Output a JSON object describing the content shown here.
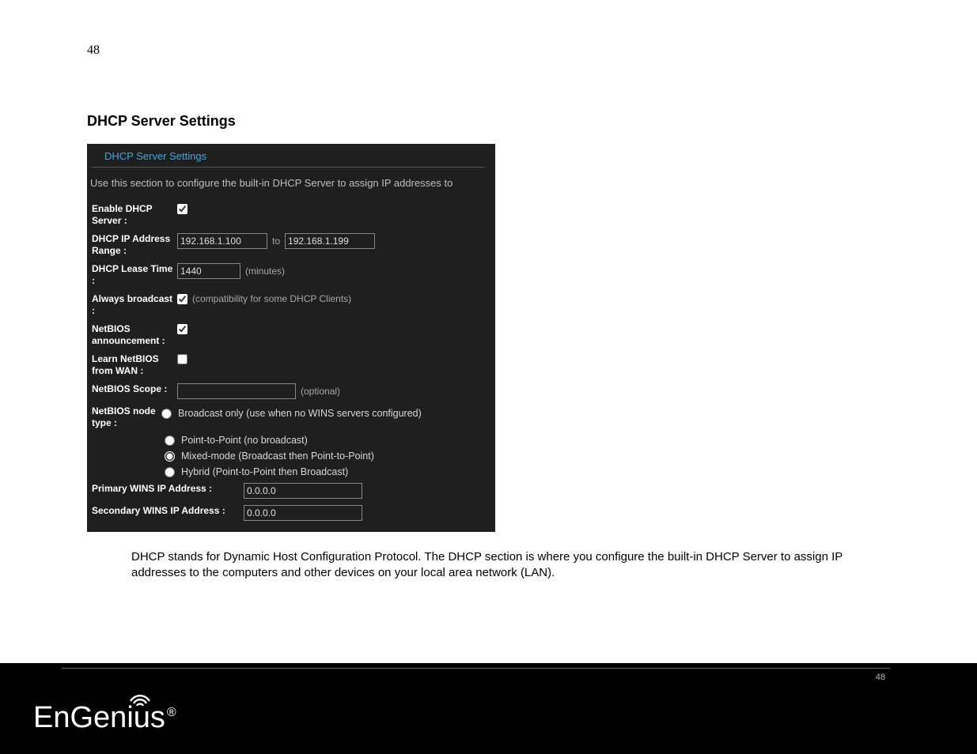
{
  "page_number_top": "48",
  "section_title": "DHCP Server Settings",
  "panel": {
    "header": "DHCP Server Settings",
    "description": "Use this section to configure the built-in DHCP Server to assign IP addresses to",
    "enable_label": "Enable DHCP Server :",
    "range_label": "DHCP IP Address Range :",
    "range_to": "to",
    "range_start": "192.168.1.100",
    "range_end": "192.168.1.199",
    "lease_label": "DHCP Lease Time :",
    "lease_value": "1440",
    "lease_hint": "(minutes)",
    "broadcast_label": "Always broadcast :",
    "broadcast_hint": "(compatibility for some DHCP Clients)",
    "netbios_ann_label": "NetBIOS announcement :",
    "learn_wan_label": "Learn NetBIOS from WAN :",
    "scope_label": "NetBIOS Scope :",
    "scope_value": "",
    "scope_hint": "(optional)",
    "node_label": "NetBIOS node type :",
    "node_opts": {
      "broadcast": "Broadcast only (use when no WINS servers configured)",
      "ptp": "Point-to-Point (no broadcast)",
      "mixed": "Mixed-mode (Broadcast then Point-to-Point)",
      "hybrid": "Hybrid (Point-to-Point then Broadcast)"
    },
    "pwins_label": "Primary WINS IP Address :",
    "pwins_value": "0.0.0.0",
    "swins_label": "Secondary WINS IP Address :",
    "swins_value": "0.0.0.0"
  },
  "explanation": "DHCP stands for Dynamic Host Configuration Protocol. The DHCP section is where you configure the built-in DHCP Server to assign IP addresses to the computers and other devices on your local area network (LAN).",
  "footer_page": "48",
  "brand": "EnGenius"
}
